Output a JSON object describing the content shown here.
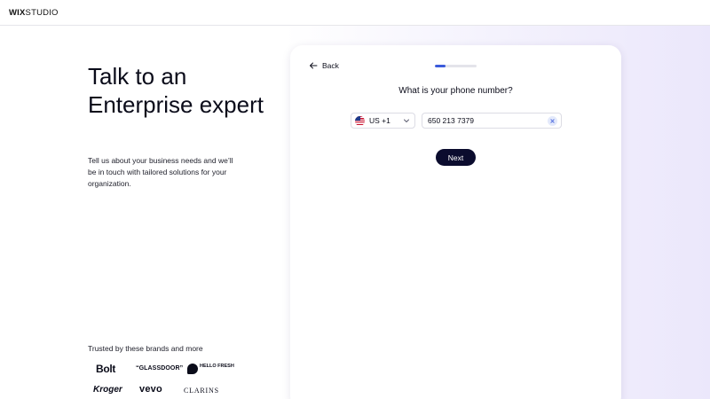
{
  "header": {
    "logo_brand": "WIX",
    "logo_product": "STUDIO"
  },
  "hero": {
    "title": "Talk to an Enterprise expert",
    "description": "Tell us about your business needs and we’ll be in touch with tailored solutions for your organization."
  },
  "trusted": {
    "label": "Trusted by these brands and more",
    "brands": [
      {
        "name": "Bolt",
        "text": "Bolt"
      },
      {
        "name": "Glassdoor",
        "text": "“GLASSDOOR”"
      },
      {
        "name": "HelloFresh",
        "text": "HELLO FRESH"
      },
      {
        "name": "Kroger",
        "text": "Kroger"
      },
      {
        "name": "Vevo",
        "text": "vevo"
      },
      {
        "name": "Clarins",
        "text": "CLARINS"
      }
    ]
  },
  "form": {
    "back_label": "Back",
    "progress": 0.25,
    "question": "What is your phone number?",
    "country": {
      "selected": "US +1",
      "flag_icon": "us-flag-icon"
    },
    "phone": {
      "value": "650 213 7379",
      "placeholder": ""
    },
    "next_label": "Next"
  },
  "colors": {
    "accent": "#3b5bdb",
    "button_bg": "#0b0c2e",
    "clear_bg": "#e3e9fb"
  }
}
